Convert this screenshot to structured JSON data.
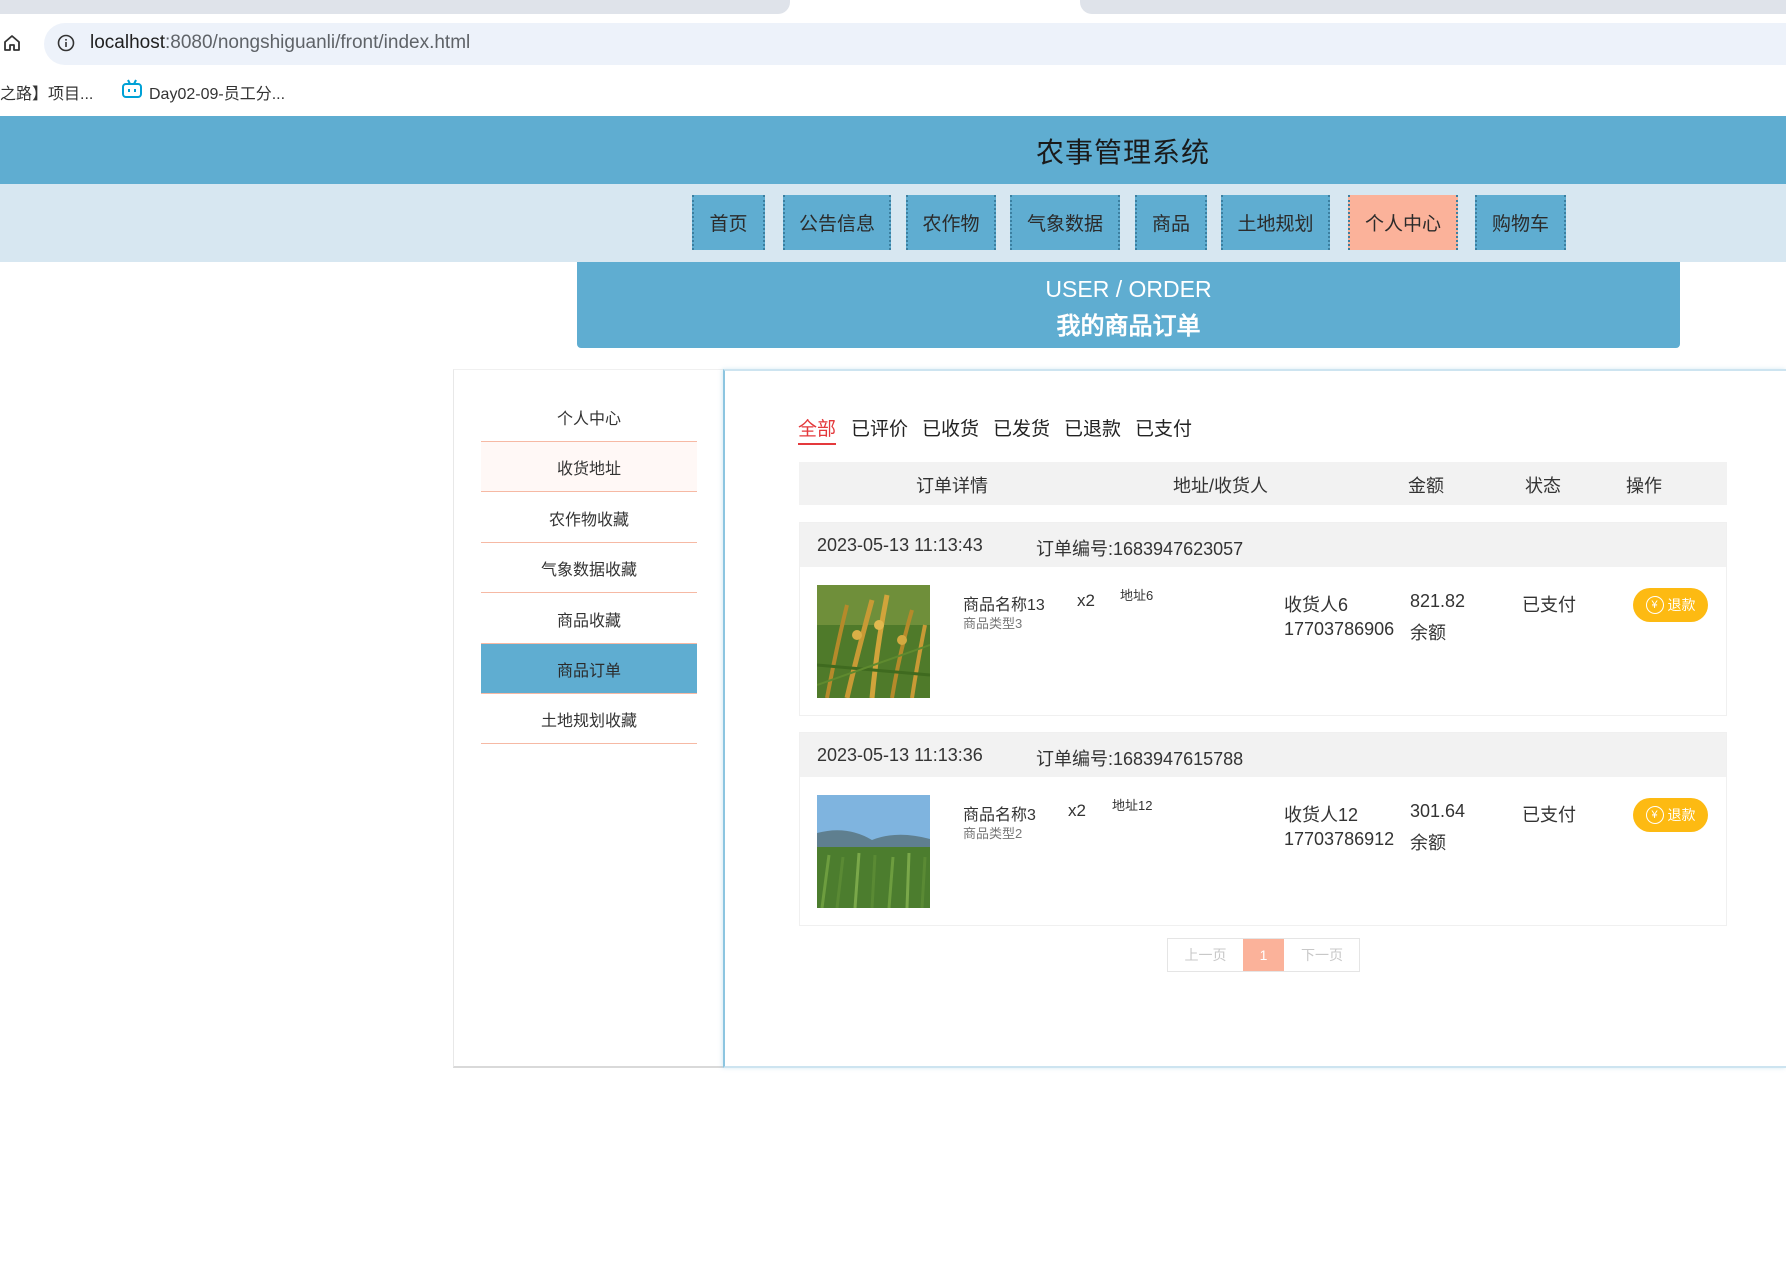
{
  "browser": {
    "url_host": "localhost",
    "url_rest": ":8080/nongshiguanli/front/index.html",
    "bookmarks": [
      "之路】项目...",
      "Day02-09-员工分..."
    ]
  },
  "site": {
    "title": "农事管理系统",
    "nav": [
      "首页",
      "公告信息",
      "农作物",
      "气象数据",
      "商品",
      "土地规划",
      "个人中心",
      "购物车"
    ],
    "active_nav": "个人中心"
  },
  "banner": {
    "en": "USER / ORDER",
    "cn": "我的商品订单"
  },
  "sidebar": {
    "items": [
      "个人中心",
      "收货地址",
      "农作物收藏",
      "气象数据收藏",
      "商品收藏",
      "商品订单",
      "土地规划收藏"
    ],
    "active": "商品订单"
  },
  "filters": [
    "全部",
    "已评价",
    "已收货",
    "已发货",
    "已退款",
    "已支付"
  ],
  "active_filter": "全部",
  "table_headers": [
    "订单详情",
    "地址/收货人",
    "金额",
    "状态",
    "操作"
  ],
  "orders": [
    {
      "date": "2023-05-13 11:13:43",
      "order_no": "订单编号:1683947623057",
      "product_name": "商品名称13",
      "product_type": "商品类型3",
      "qty": "x2",
      "address": "地址6",
      "receiver": "收货人6",
      "phone": "17703786906",
      "amount": "821.82",
      "pay_method": "余额",
      "status": "已支付",
      "action": "退款",
      "image": "rice-field"
    },
    {
      "date": "2023-05-13 11:13:36",
      "order_no": "订单编号:1683947615788",
      "product_name": "商品名称3",
      "product_type": "商品类型2",
      "qty": "x2",
      "address": "地址12",
      "receiver": "收货人12",
      "phone": "17703786912",
      "amount": "301.64",
      "pay_method": "余额",
      "status": "已支付",
      "action": "退款",
      "image": "corn-field"
    }
  ],
  "pagination": {
    "prev": "上一页",
    "current": "1",
    "next": "下一页"
  },
  "colors": {
    "primary": "#5fadd1",
    "accent": "#fbb29a",
    "refund": "#fdba12",
    "filter_active": "#e4393c"
  },
  "icons": {
    "home": "home-icon",
    "info": "info-icon",
    "bilibili": "bilibili-icon",
    "yen": "yen-icon"
  }
}
